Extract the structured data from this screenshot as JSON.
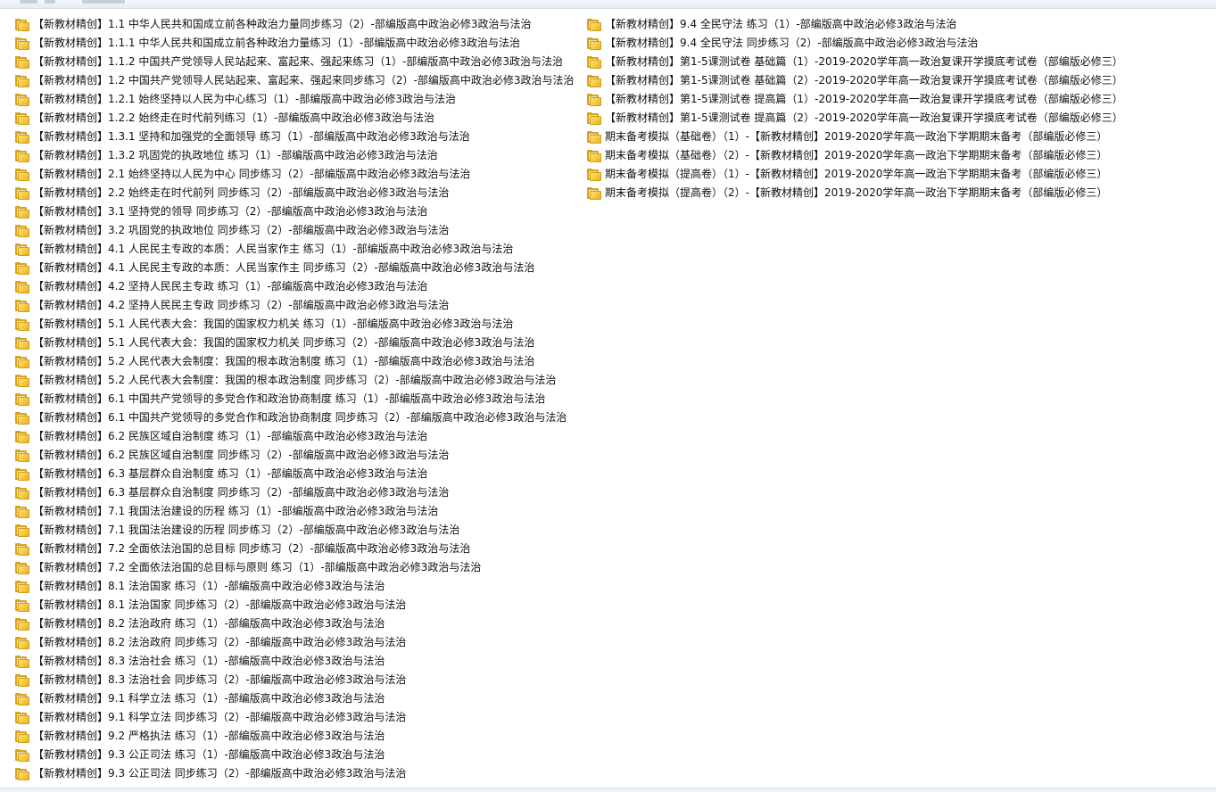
{
  "left_items": [
    "【新教材精创】1.1 中华人民共和国成立前各种政治力量同步练习（2）-部编版高中政治必修3政治与法治",
    "【新教材精创】1.1.1 中华人民共和国成立前各种政治力量练习（1）-部编版高中政治必修3政治与法治",
    "【新教材精创】1.1.2 中国共产党领导人民站起来、富起来、强起来练习（1）-部编版高中政治必修3政治与法治",
    "【新教材精创】1.2 中国共产党领导人民站起来、富起来、强起来同步练习（2）-部编版高中政治必修3政治与法治",
    "【新教材精创】1.2.1 始终坚持以人民为中心练习（1）-部编版高中政治必修3政治与法治",
    "【新教材精创】1.2.2 始终走在时代前列练习（1）-部编版高中政治必修3政治与法治",
    "【新教材精创】1.3.1 坚持和加强党的全面领导 练习（1）-部编版高中政治必修3政治与法治",
    "【新教材精创】1.3.2 巩固党的执政地位 练习（1）-部编版高中政治必修3政治与法治",
    "【新教材精创】2.1 始终坚持以人民为中心 同步练习（2）-部编版高中政治必修3政治与法治",
    "【新教材精创】2.2 始终走在时代前列 同步练习（2）-部编版高中政治必修3政治与法治",
    "【新教材精创】3.1 坚持党的领导 同步练习（2）-部编版高中政治必修3政治与法治",
    "【新教材精创】3.2 巩固党的执政地位 同步练习（2）-部编版高中政治必修3政治与法治",
    "【新教材精创】4.1 人民民主专政的本质：人民当家作主 练习（1）-部编版高中政治必修3政治与法治",
    "【新教材精创】4.1 人民民主专政的本质：人民当家作主 同步练习（2）-部编版高中政治必修3政治与法治",
    "【新教材精创】4.2 坚持人民民主专政 练习（1）-部编版高中政治必修3政治与法治",
    "【新教材精创】4.2 坚持人民民主专政 同步练习（2）-部编版高中政治必修3政治与法治",
    "【新教材精创】5.1 人民代表大会：我国的国家权力机关 练习（1）-部编版高中政治必修3政治与法治",
    "【新教材精创】5.1 人民代表大会：我国的国家权力机关 同步练习（2）-部编版高中政治必修3政治与法治",
    "【新教材精创】5.2 人民代表大会制度：我国的根本政治制度 练习（1）-部编版高中政治必修3政治与法治",
    "【新教材精创】5.2 人民代表大会制度：我国的根本政治制度 同步练习（2）-部编版高中政治必修3政治与法治",
    "【新教材精创】6.1 中国共产党领导的多党合作和政治协商制度 练习（1）-部编版高中政治必修3政治与法治",
    "【新教材精创】6.1 中国共产党领导的多党合作和政治协商制度 同步练习（2）-部编版高中政治必修3政治与法治",
    "【新教材精创】6.2 民族区域自治制度 练习（1）-部编版高中政治必修3政治与法治",
    "【新教材精创】6.2 民族区域自治制度 同步练习（2）-部编版高中政治必修3政治与法治",
    "【新教材精创】6.3 基层群众自治制度 练习（1）-部编版高中政治必修3政治与法治",
    "【新教材精创】6.3 基层群众自治制度 同步练习（2）-部编版高中政治必修3政治与法治",
    "【新教材精创】7.1 我国法治建设的历程 练习（1）-部编版高中政治必修3政治与法治",
    "【新教材精创】7.1 我国法治建设的历程 同步练习（2）-部编版高中政治必修3政治与法治",
    "【新教材精创】7.2 全面依法治国的总目标 同步练习（2）-部编版高中政治必修3政治与法治",
    "【新教材精创】7.2 全面依法治国的总目标与原则 练习（1）-部编版高中政治必修3政治与法治",
    "【新教材精创】8.1 法治国家 练习（1）-部编版高中政治必修3政治与法治",
    "【新教材精创】8.1 法治国家 同步练习（2）-部编版高中政治必修3政治与法治",
    "【新教材精创】8.2 法治政府 练习（1）-部编版高中政治必修3政治与法治",
    "【新教材精创】8.2 法治政府 同步练习（2）-部编版高中政治必修3政治与法治",
    "【新教材精创】8.3 法治社会 练习（1）-部编版高中政治必修3政治与法治",
    "【新教材精创】8.3 法治社会 同步练习（2）-部编版高中政治必修3政治与法治",
    "【新教材精创】9.1 科学立法 练习（1）-部编版高中政治必修3政治与法治",
    "【新教材精创】9.1 科学立法 同步练习（2）-部编版高中政治必修3政治与法治",
    "【新教材精创】9.2 严格执法 练习（1）-部编版高中政治必修3政治与法治",
    "【新教材精创】9.3 公正司法 练习（1）-部编版高中政治必修3政治与法治",
    "【新教材精创】9.3 公正司法 同步练习（2）-部编版高中政治必修3政治与法治"
  ],
  "right_items": [
    "【新教材精创】9.4 全民守法 练习（1）-部编版高中政治必修3政治与法治",
    "【新教材精创】9.4 全民守法 同步练习（2）-部编版高中政治必修3政治与法治",
    "【新教材精创】第1-5课测试卷 基础篇（1）-2019-2020学年高一政治复课开学摸底考试卷（部编版必修三）",
    "【新教材精创】第1-5课测试卷 基础篇（2）-2019-2020学年高一政治复课开学摸底考试卷（部编版必修三）",
    "【新教材精创】第1-5课测试卷 提高篇（1）-2019-2020学年高一政治复课开学摸底考试卷（部编版必修三）",
    "【新教材精创】第1-5课测试卷 提高篇（2）-2019-2020学年高一政治复课开学摸底考试卷（部编版必修三）",
    "期末备考模拟（基础卷）（1）-【新教材精创】2019-2020学年高一政治下学期期末备考（部编版必修三）",
    "期末备考模拟（基础卷）（2）-【新教材精创】2019-2020学年高一政治下学期期末备考（部编版必修三）",
    "期末备考模拟（提高卷）（1）-【新教材精创】2019-2020学年高一政治下学期期末备考（部编版必修三）",
    "期末备考模拟（提高卷）（2）-【新教材精创】2019-2020学年高一政治下学期期末备考（部编版必修三）"
  ],
  "icons": {
    "item_icon": "folder-icon"
  },
  "colors": {
    "folder_front": "#f5c842",
    "folder_back": "#d9a419",
    "text": "#111111",
    "background": "#ffffff"
  }
}
